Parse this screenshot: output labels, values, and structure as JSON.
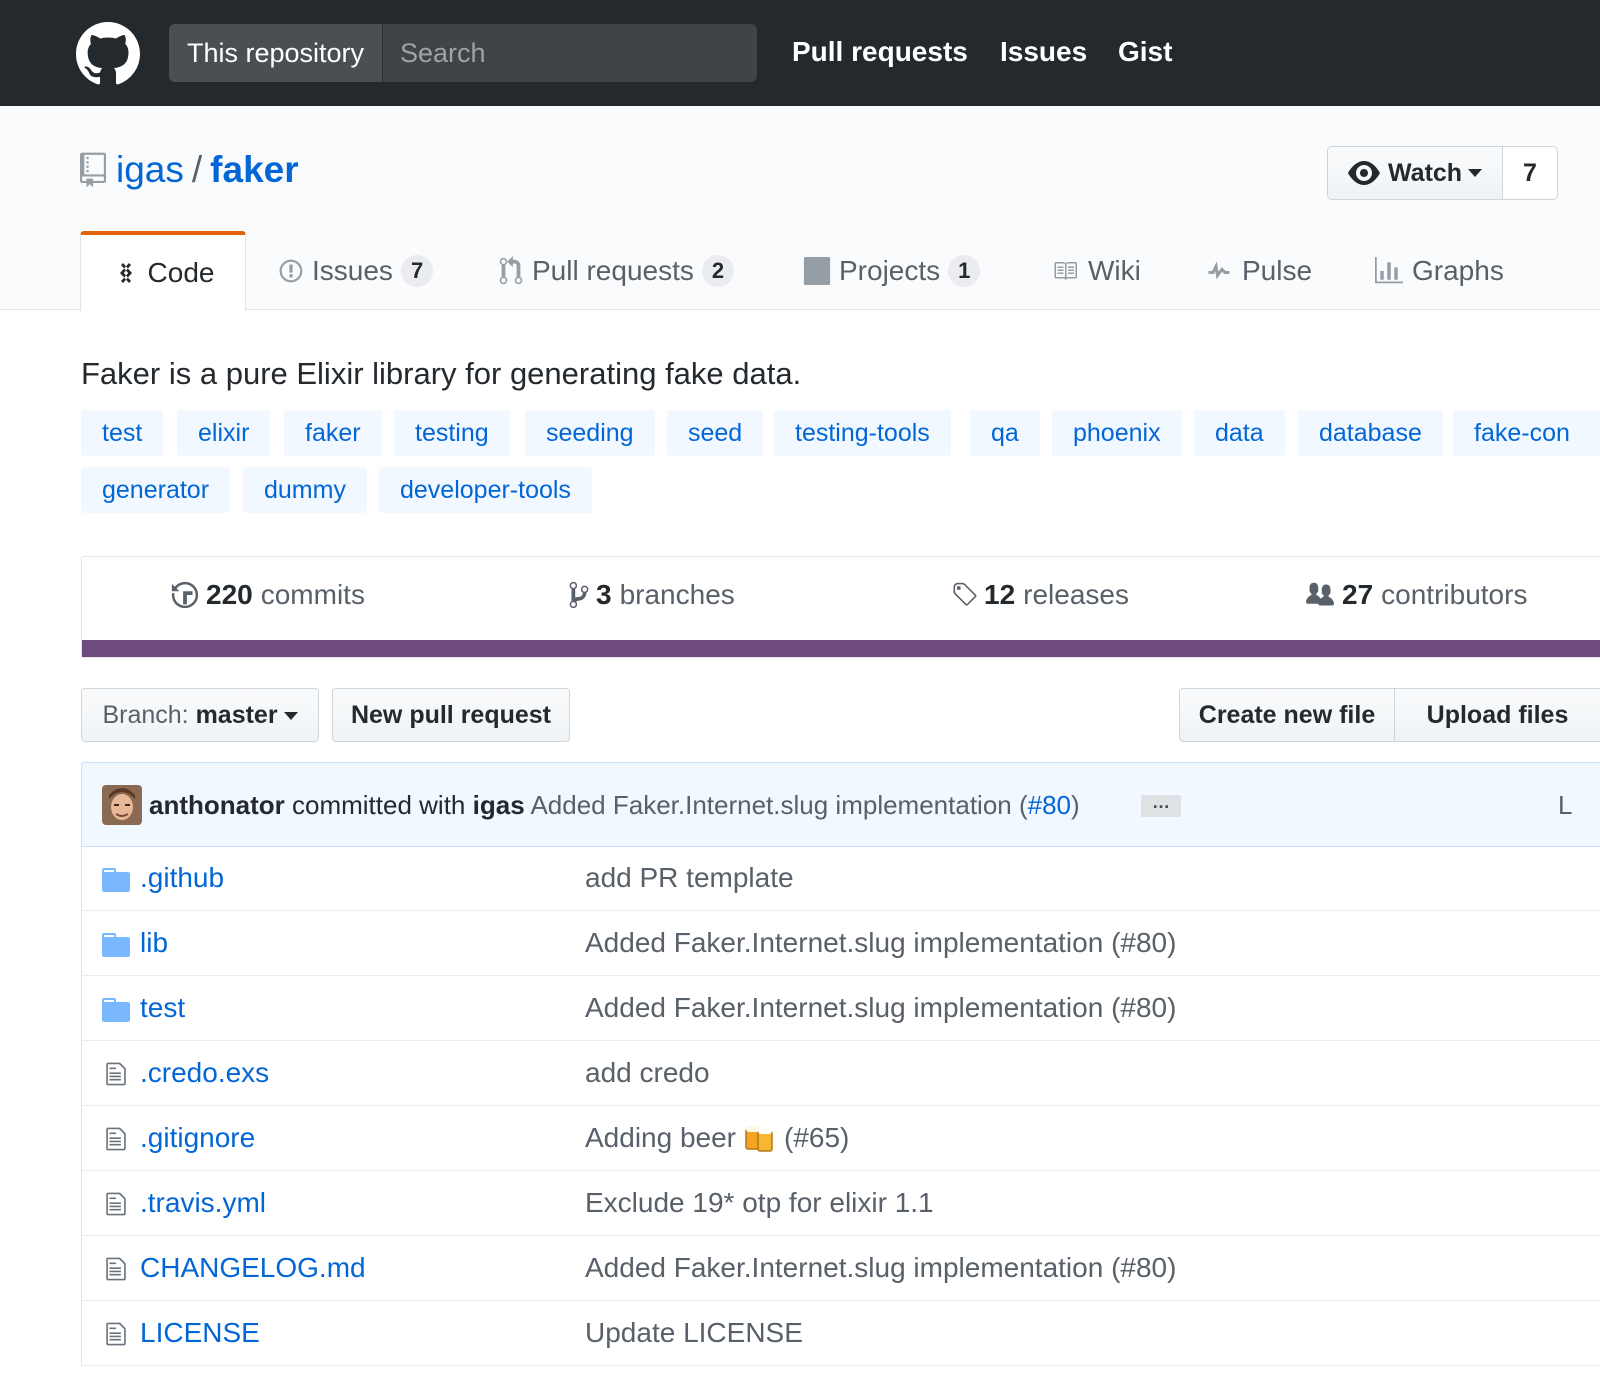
{
  "header": {
    "scope_label": "This repository",
    "search_placeholder": "Search",
    "nav": [
      "Pull requests",
      "Issues",
      "Gist"
    ]
  },
  "repo": {
    "owner": "igas",
    "separator": "/",
    "name": "faker",
    "watch_label": "Watch",
    "watch_count": "7"
  },
  "tabs": [
    {
      "label": "Code",
      "icon": "code-icon",
      "counter": ""
    },
    {
      "label": "Issues",
      "icon": "issue-opened-icon",
      "counter": "7"
    },
    {
      "label": "Pull requests",
      "icon": "git-pull-request-icon",
      "counter": "2"
    },
    {
      "label": "Projects",
      "icon": "project-icon",
      "counter": "1"
    },
    {
      "label": "Wiki",
      "icon": "book-icon",
      "counter": ""
    },
    {
      "label": "Pulse",
      "icon": "pulse-icon",
      "counter": ""
    },
    {
      "label": "Graphs",
      "icon": "graph-icon",
      "counter": ""
    }
  ],
  "description": "Faker is a pure Elixir library for generating fake data.",
  "topics": [
    "test",
    "elixir",
    "faker",
    "testing",
    "seeding",
    "seed",
    "testing-tools",
    "qa",
    "phoenix",
    "data",
    "database",
    "fake-con",
    "generator",
    "dummy",
    "developer-tools"
  ],
  "summary": {
    "commits": {
      "count": "220",
      "label": "commits"
    },
    "branches": {
      "count": "3",
      "label": "branches"
    },
    "releases": {
      "count": "12",
      "label": "releases"
    },
    "contributors": {
      "count": "27",
      "label": "contributors"
    },
    "language_color": "#6e4a7e"
  },
  "file_nav": {
    "branch_prefix": "Branch:",
    "branch_name": "master",
    "new_pr": "New pull request",
    "create_file": "Create new file",
    "upload_files": "Upload files"
  },
  "commit": {
    "author": "anthonator",
    "committed_with": "committed with",
    "committer": "igas",
    "message": "Added Faker.Internet.slug implementation (",
    "pr_link": "#80",
    "message_end": ")",
    "ellipsis": "…",
    "latest": "L"
  },
  "files": [
    {
      "type": "folder",
      "name": ".github",
      "message": "add PR template"
    },
    {
      "type": "folder",
      "name": "lib",
      "message": "Added Faker.Internet.slug implementation (#80)"
    },
    {
      "type": "folder",
      "name": "test",
      "message": "Added Faker.Internet.slug implementation (#80)"
    },
    {
      "type": "file",
      "name": ".credo.exs",
      "message": "add credo"
    },
    {
      "type": "file",
      "name": ".gitignore",
      "message": "Adding beer",
      "message_suffix": "(#65)",
      "emoji": "beers-emoji"
    },
    {
      "type": "file",
      "name": ".travis.yml",
      "message": "Exclude 19* otp for elixir 1.1"
    },
    {
      "type": "file",
      "name": "CHANGELOG.md",
      "message": "Added Faker.Internet.slug implementation (#80)"
    },
    {
      "type": "file",
      "name": "LICENSE",
      "message": "Update LICENSE"
    }
  ]
}
